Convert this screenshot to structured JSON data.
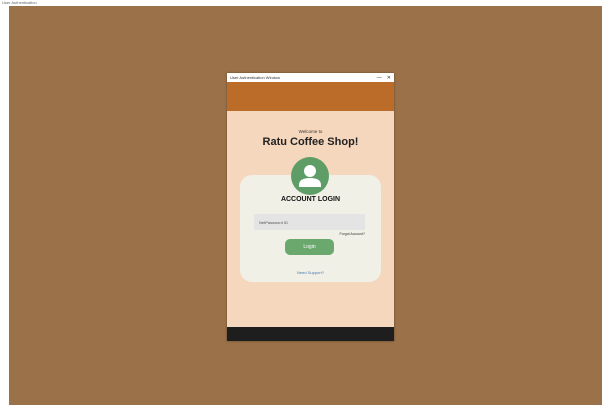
{
  "screen": {
    "title": "User Authentication"
  },
  "window": {
    "title": "User Authentication Window",
    "controls": {
      "minimize": "—",
      "close": "✕"
    }
  },
  "login": {
    "welcome": "Welcome to",
    "shop_name": "Ratu Coffee Shop!",
    "heading": "ACCOUNT LOGIN",
    "input_placeholder": "NetPassword ID",
    "forgot_link": "Forgot Account?",
    "login_button": "Login",
    "support_link": "Need Support?"
  },
  "icons": {
    "avatar": "user-icon"
  },
  "colors": {
    "desktop": "#9a7148",
    "window_bg": "#f5d7bd",
    "header": "#bb6c28",
    "card": "#f1f0e6",
    "accent_green": "#6aa86e",
    "footer": "#1e1e1e",
    "link": "#4a78b5"
  }
}
